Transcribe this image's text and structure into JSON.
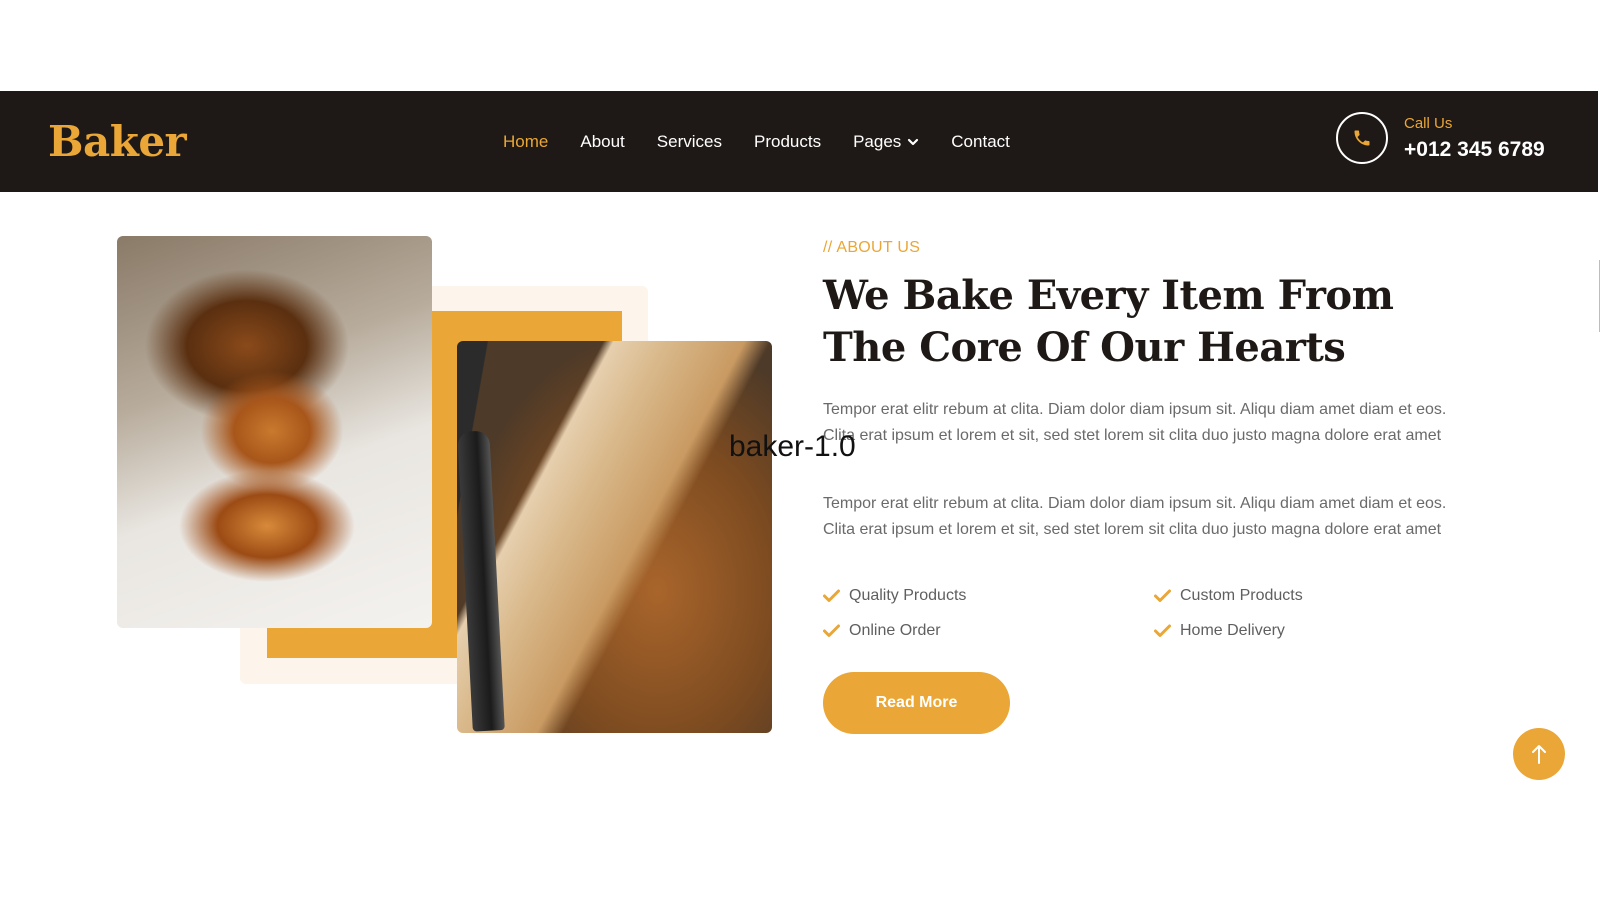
{
  "navbar": {
    "logo": "Baker",
    "items": [
      {
        "label": "Home",
        "active": true
      },
      {
        "label": "About"
      },
      {
        "label": "Services"
      },
      {
        "label": "Products"
      },
      {
        "label": "Pages",
        "dropdown": true
      },
      {
        "label": "Contact"
      }
    ],
    "call": {
      "label": "Call Us",
      "number": "+012 345 6789",
      "icon": "phone-icon"
    }
  },
  "about": {
    "eyebrow": "// ABOUT US",
    "heading": "We Bake Every Item From The Core Of Our Hearts",
    "paragraphs": [
      "Tempor erat elitr rebum at clita. Diam dolor diam ipsum sit. Aliqu diam amet diam et eos. Clita erat ipsum et lorem et sit, sed stet lorem sit clita duo justo magna dolore erat amet",
      "Tempor erat elitr rebum at clita. Diam dolor diam ipsum sit. Aliqu diam amet diam et eos. Clita erat ipsum et lorem et sit, sed stet lorem sit clita duo justo magna dolore erat amet"
    ],
    "features": [
      "Quality Products",
      "Custom Products",
      "Online Order",
      "Home Delivery"
    ],
    "read_more": "Read More"
  },
  "watermark": "baker-1.0",
  "colors": {
    "accent": "#eaa636",
    "dark": "#1e1916",
    "text": "#6a6a6a"
  }
}
